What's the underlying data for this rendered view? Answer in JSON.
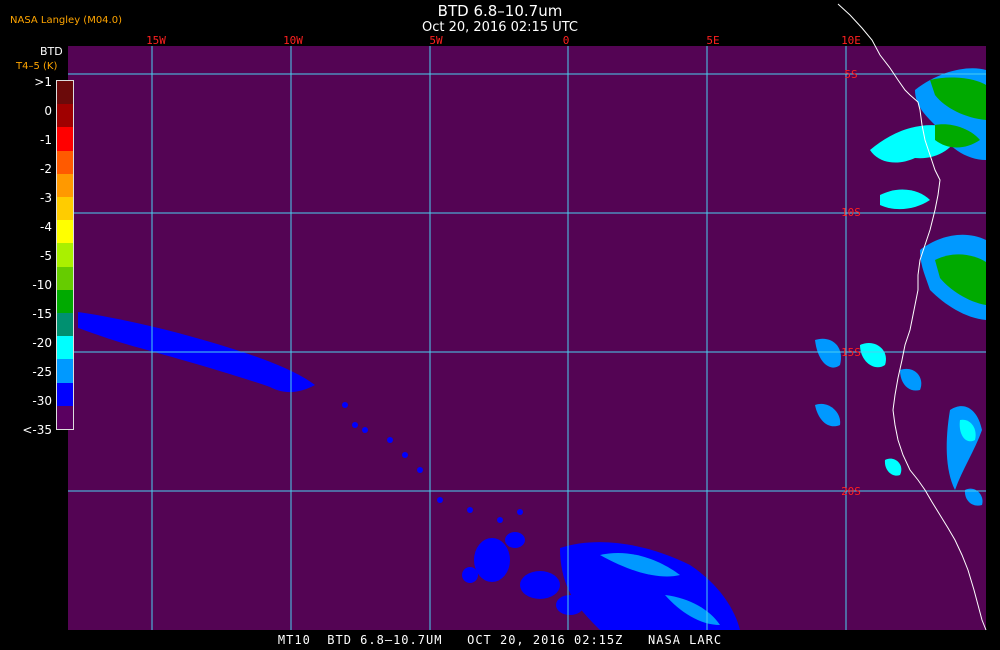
{
  "header": {
    "title": "BTD 6.8–10.7um",
    "subtitle": "Oct 20, 2016 02:15 UTC",
    "provider": "NASA Langley (M04.0)"
  },
  "legend": {
    "title": "BTD",
    "units": "T4–5 (K)",
    "ticks": [
      ">1",
      "0",
      "-1",
      "-2",
      "-3",
      "-4",
      "-5",
      "-10",
      "-15",
      "-20",
      "-25",
      "-30",
      "<-35"
    ],
    "colors": [
      "#6b0a0a",
      "#a00000",
      "#ff0000",
      "#ff5a00",
      "#ff9900",
      "#ffcc00",
      "#ffff00",
      "#aaf000",
      "#66cc00",
      "#00aa00",
      "#009070",
      "#00ffff",
      "#0099ff",
      "#0000ff",
      "#5a0060"
    ]
  },
  "map": {
    "background_color": "#540454",
    "grid_color": "#4ad0f0",
    "label_color": "#ff2020",
    "longitude_labels": [
      "15W",
      "10W",
      "5W",
      "0",
      "5E",
      "10E"
    ],
    "latitude_labels": [
      "5S",
      "10S",
      "15S",
      "20S"
    ],
    "coastline_color": "#ffffff",
    "low_btd_color": "#0000ff",
    "mid_btd_color": "#0099ff",
    "cyan_btd_color": "#00ffff",
    "green_btd_color": "#00aa00"
  },
  "footer": {
    "caption": "MT10  BTD 6.8–10.7UM   OCT 20, 2016 02:15Z   NASA LARC"
  }
}
